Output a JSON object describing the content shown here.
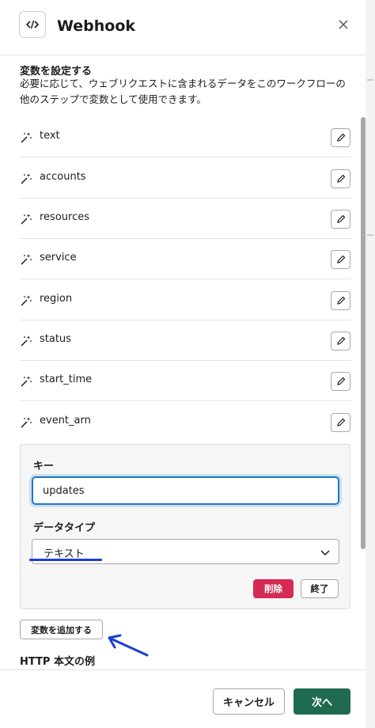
{
  "header": {
    "title": "Webhook",
    "app_icon": "code-brackets-icon",
    "close_icon": "close-icon"
  },
  "variables_section": {
    "title": "変数を設定する",
    "description": "必要に応じて、ウェブリクエストに含まれるデータをこのワークフローの他のステップで変数として使用できます。",
    "items": [
      {
        "name": "text"
      },
      {
        "name": "accounts"
      },
      {
        "name": "resources"
      },
      {
        "name": "service"
      },
      {
        "name": "region"
      },
      {
        "name": "status"
      },
      {
        "name": "start_time"
      },
      {
        "name": "event_arn"
      }
    ]
  },
  "edit_panel": {
    "key_label": "キー",
    "key_value": "updates",
    "type_label": "データタイプ",
    "type_selected": "テキスト",
    "delete_label": "削除",
    "done_label": "終了"
  },
  "add_variable_label": "変数を追加する",
  "http_body_title": "HTTP 本文の例",
  "footer": {
    "cancel_label": "キャンセル",
    "next_label": "次へ"
  },
  "colors": {
    "primary": "#1f6b4f",
    "danger": "#d42a54",
    "focus": "#1d78c9",
    "annotation": "#1a3fd8"
  }
}
